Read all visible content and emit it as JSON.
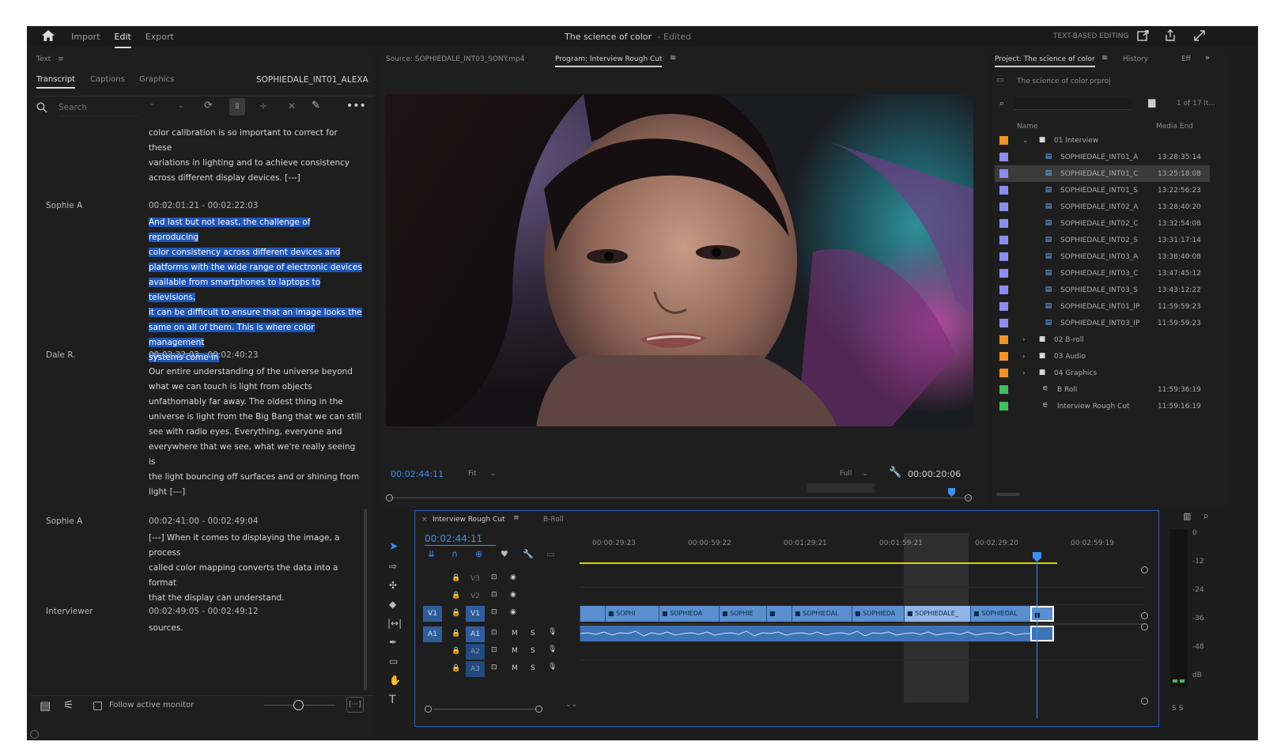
{
  "topbar": {
    "nav": [
      "Import",
      "Edit",
      "Export"
    ],
    "title": "The science of color",
    "title_status": "- Edited",
    "right_label": "TEXT-BASED EDITING"
  },
  "left": {
    "panel_title": "Text",
    "tabs": [
      "Transcript",
      "Captions",
      "Graphics"
    ],
    "clip_name": "SOPHIEDALE_INT01_ALEXA",
    "search_placeholder": "Search",
    "entries": [
      {
        "speaker": "",
        "tc": "",
        "lines": [
          "color calibration is so important to correct for these",
          "variations in lighting and to achieve consistency",
          "across different display devices. [---]"
        ],
        "selected": false
      },
      {
        "speaker": "Sophie A",
        "tc": "00:02:01:21 - 00:02:22:03",
        "lines": [
          "And last but not least, the challenge of reproducing",
          "color consistency across different devices and",
          "platforms with the wide range of electronic devices",
          "available from smartphones to laptops to televisions,",
          "it can be difficult to ensure that an image looks the",
          "same on all of them. This is where color management",
          "systems come in"
        ],
        "selected": true
      },
      {
        "speaker": "Dale R.",
        "tc": "00:02:22:03 - 00:02:40:23",
        "lines": [
          "Our entire understanding of the universe beyond",
          "what we can touch is light from objects",
          "unfathomably far away. The oldest thing in the",
          "universe is light from the Big Bang that we can still",
          "see with radio eyes. Everything, everyone and",
          "everywhere that we see, what we're really seeing is",
          "the light bouncing off surfaces and or shining from",
          "light [---]"
        ],
        "selected": false
      },
      {
        "speaker": "Sophie A",
        "tc": "00:02:41:00 - 00:02:49:04",
        "lines": [
          "[---] When it comes to displaying the image, a process",
          "called color mapping converts the data into a format",
          "that the display can understand."
        ],
        "selected": false
      },
      {
        "speaker": "Interviewer",
        "tc": "00:02:49:05 - 00:02:49:12",
        "lines": [
          "sources."
        ],
        "selected": false
      }
    ],
    "follow_label": "Follow active monitor"
  },
  "monitor": {
    "source_tab": "Source: SOPHIEDALE_INT03_SONY.mp4",
    "program_tab": "Program: Interview Rough Cut",
    "timecode": "00:02:44:11",
    "fit": "Fit",
    "quality": "Full",
    "duration": "00:00:20:06"
  },
  "project": {
    "tab": "Project: The science of color",
    "tab2": "History",
    "tab3": "Eff",
    "file": "The science of color.prproj",
    "count": "1 of 17 it...",
    "col_name": "Name",
    "col_end": "Media End",
    "items": [
      {
        "name": "01 Interview",
        "end": "",
        "kind": "folder",
        "color": "#f0932b",
        "level": 0,
        "open": true
      },
      {
        "name": "SOPHIEDALE_INT01_A",
        "end": "13:28:35:14",
        "kind": "clip",
        "color": "#8d8df0",
        "level": 1
      },
      {
        "name": "SOPHIEDALE_INT01_C",
        "end": "13:25:18:08",
        "kind": "clip",
        "color": "#8d8df0",
        "level": 1,
        "selected": true
      },
      {
        "name": "SOPHIEDALE_INT01_S",
        "end": "13:22:56:23",
        "kind": "clip",
        "color": "#8d8df0",
        "level": 1
      },
      {
        "name": "SOPHIEDALE_INT02_A",
        "end": "13:28:40:20",
        "kind": "clip",
        "color": "#8d8df0",
        "level": 1
      },
      {
        "name": "SOPHIEDALE_INT02_C",
        "end": "13:32:54:08",
        "kind": "clip",
        "color": "#8d8df0",
        "level": 1
      },
      {
        "name": "SOPHIEDALE_INT02_S",
        "end": "13:31:17:14",
        "kind": "clip",
        "color": "#8d8df0",
        "level": 1
      },
      {
        "name": "SOPHIEDALE_INT03_A",
        "end": "13:38:40:08",
        "kind": "clip",
        "color": "#8d8df0",
        "level": 1
      },
      {
        "name": "SOPHIEDALE_INT03_C",
        "end": "13:47:45:12",
        "kind": "clip",
        "color": "#8d8df0",
        "level": 1
      },
      {
        "name": "SOPHIEDALE_INT03_S",
        "end": "13:43:12:22",
        "kind": "clip",
        "color": "#8d8df0",
        "level": 1
      },
      {
        "name": "SOPHIEDALE_INT01_IP",
        "end": "11:59:59:23",
        "kind": "clip",
        "color": "#8d8df0",
        "level": 1
      },
      {
        "name": "SOPHIEDALE_INT03_IP",
        "end": "11:59:59:23",
        "kind": "clip",
        "color": "#8d8df0",
        "level": 1
      },
      {
        "name": "02 B-roll",
        "end": "",
        "kind": "folder",
        "color": "#f0932b",
        "level": 0
      },
      {
        "name": "03 Audio",
        "end": "",
        "kind": "folder",
        "color": "#f0932b",
        "level": 0
      },
      {
        "name": "04 Graphics",
        "end": "",
        "kind": "folder",
        "color": "#f0932b",
        "level": 0
      },
      {
        "name": "B Roll",
        "end": "11:59:36:19",
        "kind": "seq",
        "color": "#3fbf5f",
        "level": 0
      },
      {
        "name": "Interview Rough Cut",
        "end": "11:59:16:19",
        "kind": "seq",
        "color": "#3fbf5f",
        "level": 0
      }
    ]
  },
  "timeline": {
    "tab": "Interview Rough Cut",
    "tab2": "B-Roll",
    "timecode": "00:02:44:11",
    "ruler": [
      "00:00:29:23",
      "00:00:59:22",
      "00:01:29:21",
      "00:01:59:21",
      "00:02:29:20",
      "00:02:59:19"
    ],
    "video_tracks": [
      "V3",
      "V2",
      "V1"
    ],
    "audio_tracks": [
      "A1",
      "A2",
      "A3"
    ],
    "src_v": "V1",
    "src_a": "A1",
    "clips": [
      "SOPHI",
      "SOPHIEDA",
      "SOPHIE",
      "SOPHIEDAL",
      "SOPHIEDA",
      "SOPHIEDALE_",
      "SOPHIEDAL"
    ],
    "meter_ticks": [
      "0",
      "-12",
      "-24",
      "-36",
      "-48",
      "dB"
    ],
    "meter_foot": "S S"
  }
}
